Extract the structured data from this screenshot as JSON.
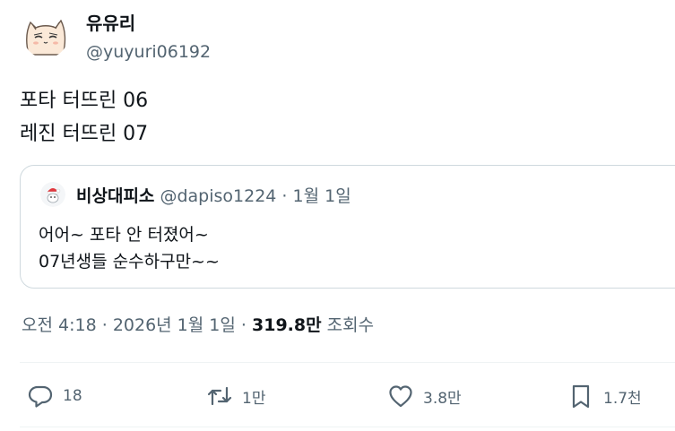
{
  "tweet": {
    "author_name": "유유리",
    "author_handle": "@yuyuri06192",
    "lines": [
      "포타 터뜨린 06",
      "레진 터뜨린 07"
    ]
  },
  "quote": {
    "author_name": "비상대피소",
    "author_handle": "@dapiso1224",
    "separator": "·",
    "date": "1월 1일",
    "lines": [
      "어어~ 포타 안 터졌어~",
      "07년생들 순수하구만~~"
    ]
  },
  "meta": {
    "time": "오전 4:18",
    "separator": "·",
    "date": "2026년 1월 1일",
    "views_count": "319.8만",
    "views_label": "조회수"
  },
  "actions": {
    "replies": "18",
    "retweets": "1만",
    "likes": "3.8만",
    "bookmarks": "1.7천"
  },
  "icons": {
    "reply": "reply-icon",
    "retweet": "retweet-icon",
    "like": "heart-icon",
    "bookmark": "bookmark-icon"
  },
  "colors": {
    "text_primary": "#0f1419",
    "text_secondary": "#536471",
    "border": "#cfd9de",
    "divider": "#eff3f4"
  }
}
